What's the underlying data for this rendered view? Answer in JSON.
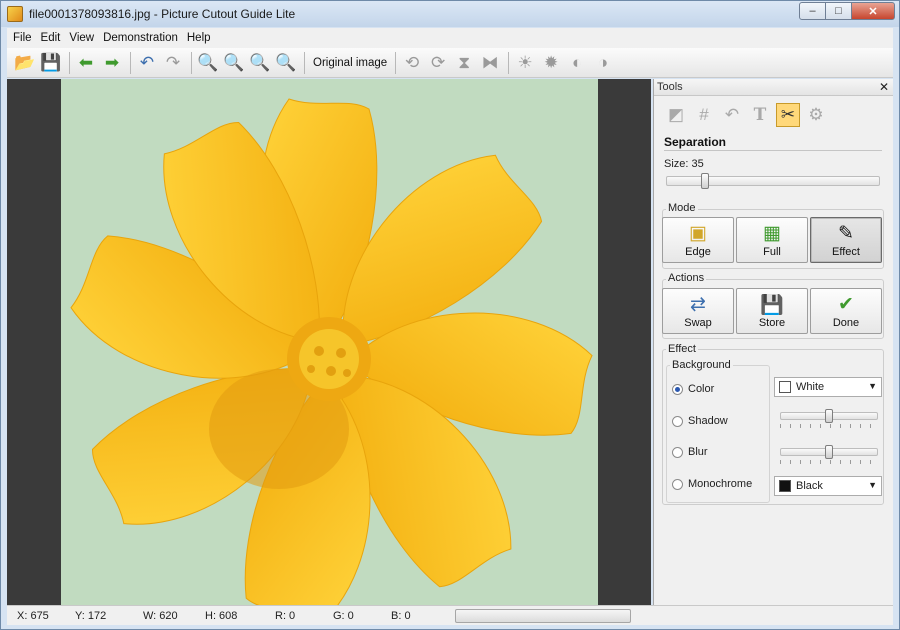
{
  "window": {
    "title": "file0001378093816.jpg - Picture Cutout Guide Lite",
    "minimize": "–",
    "maximize": "□",
    "close": "✕"
  },
  "menu": [
    "File",
    "Edit",
    "View",
    "Demonstration",
    "Help"
  ],
  "toolbar": {
    "original_image_label": "Original image"
  },
  "tools_panel": {
    "title": "Tools",
    "close": "✕",
    "section": "Separation",
    "size_label": "Size: 35",
    "size_value": 35,
    "mode": {
      "label": "Mode",
      "buttons": [
        "Edge",
        "Full",
        "Effect"
      ],
      "active": "Effect"
    },
    "actions": {
      "label": "Actions",
      "buttons": [
        "Swap",
        "Store",
        "Done"
      ]
    },
    "effect": {
      "label": "Effect",
      "background_label": "Background",
      "options": [
        "Color",
        "Shadow",
        "Blur",
        "Monochrome"
      ],
      "selected": "Color",
      "color_value": "White",
      "mono_value": "Black"
    }
  },
  "status": {
    "x": "X: 675",
    "y": "Y: 172",
    "w": "W: 620",
    "h": "H: 608",
    "r": "R: 0",
    "g": "G: 0",
    "b": "B: 0"
  },
  "colors": {
    "canvas_bg": "#3a3a3a",
    "image_bg": "#c1dbc0",
    "petal": "#f7bf16",
    "center": "#e29a10"
  }
}
